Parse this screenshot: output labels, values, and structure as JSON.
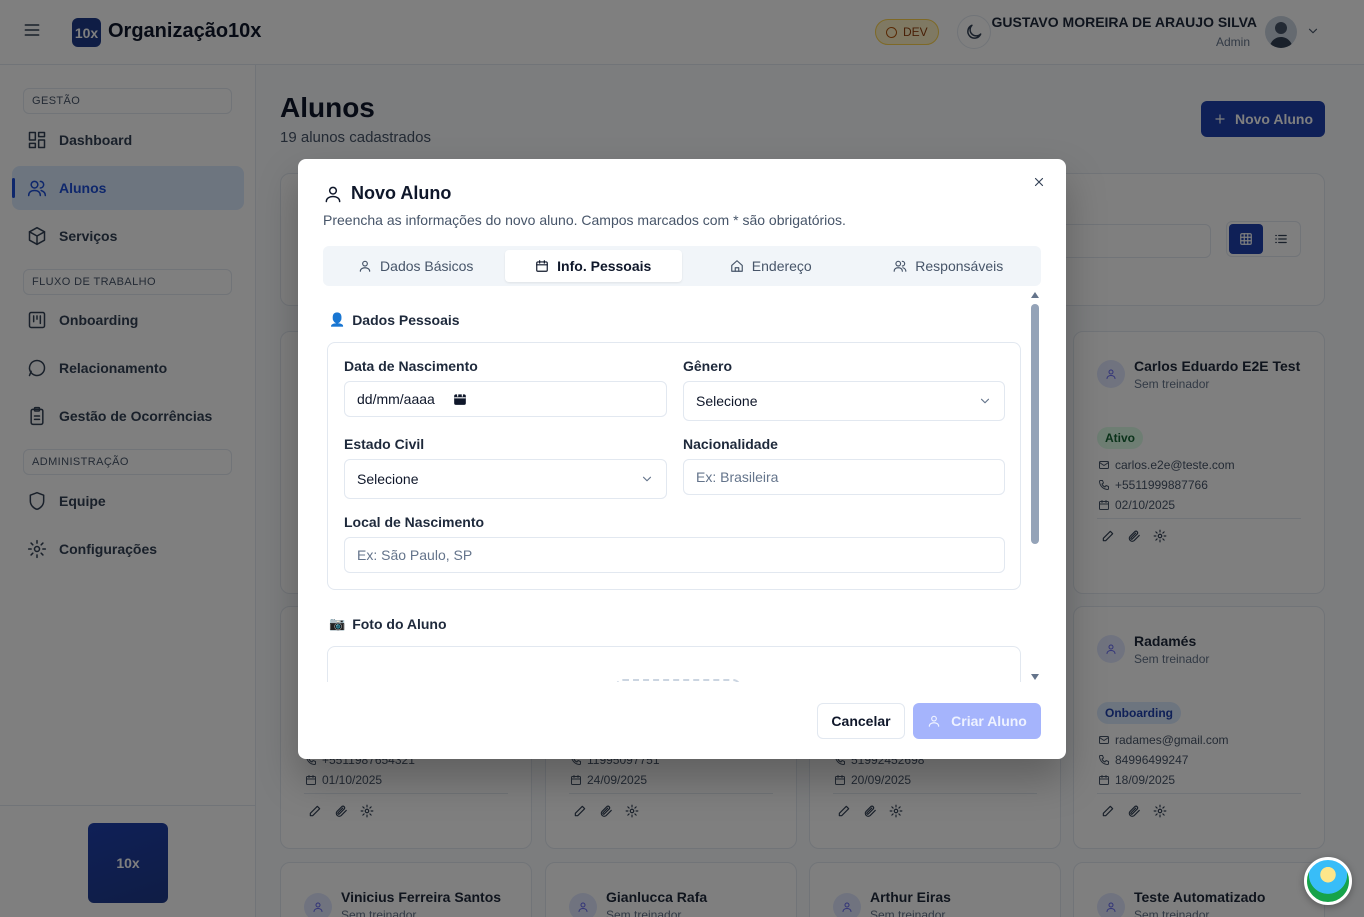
{
  "header": {
    "logo_text": "10x",
    "org_name": "Organização10x",
    "env_badge": "DEV",
    "user_name": "GUSTAVO MOREIRA DE ARAUJO SILVA",
    "user_role": "Admin"
  },
  "sidebar": {
    "sections": [
      "GESTÃO",
      "FLUXO DE TRABALHO",
      "ADMINISTRAÇÃO"
    ],
    "items": [
      {
        "label": "Dashboard",
        "icon": "dashboard-icon"
      },
      {
        "label": "Alunos",
        "icon": "users-icon",
        "active": true
      },
      {
        "label": "Serviços",
        "icon": "package-icon"
      },
      {
        "label": "Onboarding",
        "icon": "kanban-icon"
      },
      {
        "label": "Relacionamento",
        "icon": "message-circle-icon"
      },
      {
        "label": "Gestão de Ocorrências",
        "icon": "clipboard-icon"
      },
      {
        "label": "Equipe",
        "icon": "shield-icon"
      },
      {
        "label": "Configurações",
        "icon": "gear-icon"
      }
    ],
    "footer_logo": "10x"
  },
  "main": {
    "title": "Alunos",
    "subtitle": "19 alunos cadastrados",
    "new_button": "Novo Aluno"
  },
  "cards": [
    {
      "name": "Carlos Eduardo E2E Test",
      "trainer": "Sem treinador",
      "status": "Ativo",
      "email": "carlos.e2e@teste.com",
      "phone": "+5511999887766",
      "date": "02/10/2025"
    },
    {
      "name": "Radamés",
      "trainer": "Sem treinador",
      "status": "Onboarding",
      "email": "radames@gmail.com",
      "phone": "84996499247",
      "date": "18/09/2025"
    },
    {
      "phone": "+5511987654321",
      "date": "01/10/2025"
    },
    {
      "phone": "11995097751",
      "date": "24/09/2025"
    },
    {
      "phone": "51992452698",
      "date": "20/09/2025"
    },
    {
      "name": "Vinicius Ferreira Santos",
      "trainer": "Sem treinador"
    },
    {
      "name": "Gianlucca Rafa",
      "trainer": "Sem treinador"
    },
    {
      "name": "Arthur Eiras",
      "trainer": "Sem treinador"
    },
    {
      "name": "Teste Automatizado",
      "trainer": "Sem treinador"
    }
  ],
  "modal": {
    "title": "Novo Aluno",
    "description": "Preencha as informações do novo aluno. Campos marcados com * são obrigatórios.",
    "tabs": [
      {
        "label": "Dados Básicos",
        "icon": "user-icon"
      },
      {
        "label": "Info. Pessoais",
        "icon": "calendar-icon",
        "active": true
      },
      {
        "label": "Endereço",
        "icon": "home-icon"
      },
      {
        "label": "Responsáveis",
        "icon": "users-icon"
      }
    ],
    "section_personal": "Dados Pessoais",
    "section_personal_emoji": "👤",
    "fields": {
      "birth_date": {
        "label": "Data de Nascimento",
        "value": "dd/mm/aaaa"
      },
      "gender": {
        "label": "Gênero",
        "value": "Selecione"
      },
      "marital": {
        "label": "Estado Civil",
        "value": "Selecione"
      },
      "nationality": {
        "label": "Nacionalidade",
        "placeholder": "Ex: Brasileira"
      },
      "birthplace": {
        "label": "Local de Nascimento",
        "placeholder": "Ex: São Paulo, SP"
      }
    },
    "section_photo": "Foto do Aluno",
    "section_photo_emoji": "📷",
    "cancel": "Cancelar",
    "create": "Criar Aluno"
  }
}
